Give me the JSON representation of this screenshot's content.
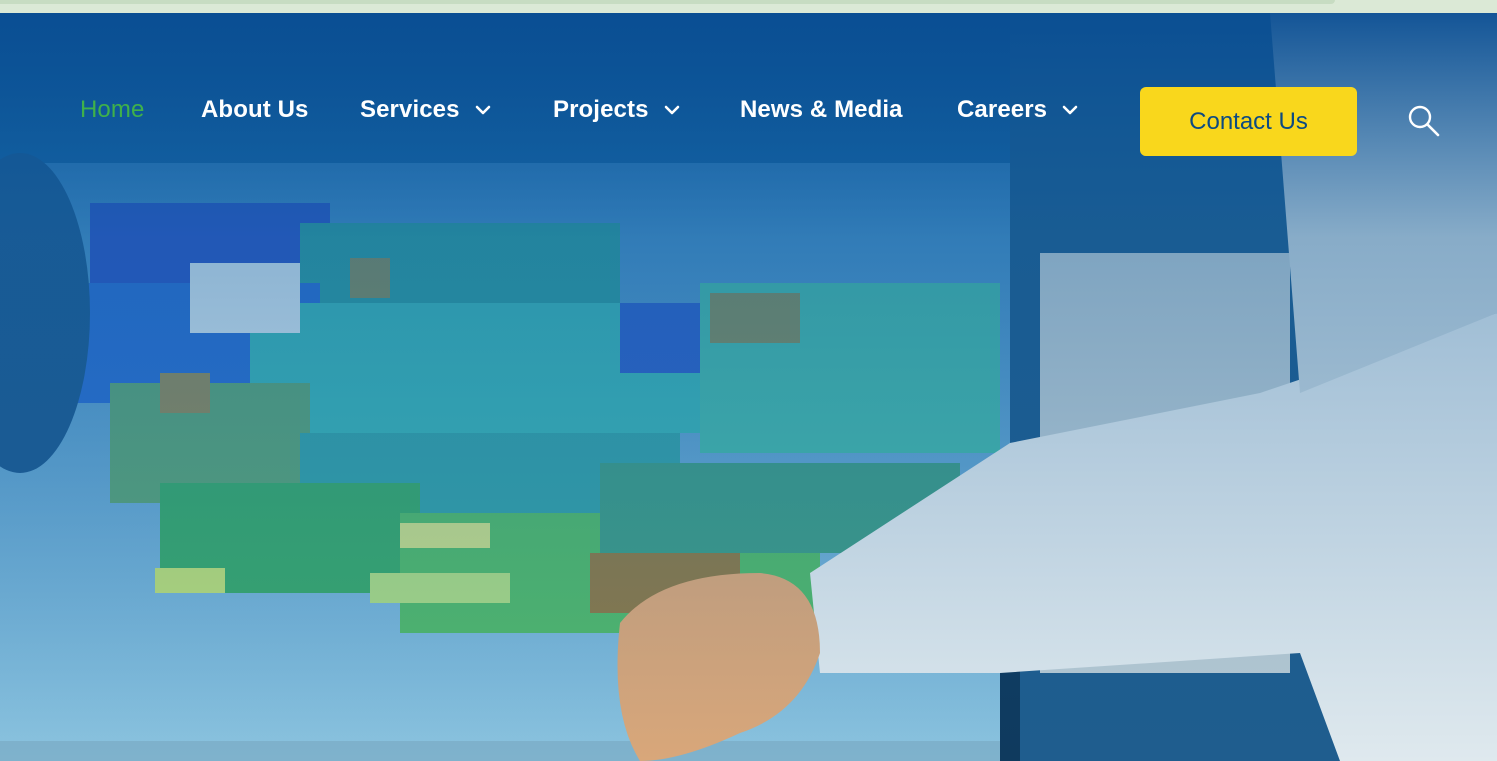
{
  "nav": {
    "items": [
      {
        "label": "Home",
        "active": true,
        "dropdown": false
      },
      {
        "label": "About Us",
        "active": false,
        "dropdown": false
      },
      {
        "label": "Services",
        "active": false,
        "dropdown": true
      },
      {
        "label": "Projects",
        "active": false,
        "dropdown": true
      },
      {
        "label": "News & Media",
        "active": false,
        "dropdown": false
      },
      {
        "label": "Careers",
        "active": false,
        "dropdown": true
      }
    ],
    "cta_label": "Contact Us",
    "search_icon": "search-icon",
    "chevron_icon": "chevron-down-icon"
  },
  "colors": {
    "nav_background": "#0b4f93",
    "active_link": "#3fb14a",
    "nav_link": "#ffffff",
    "cta_background": "#f9d71c",
    "cta_text": "#0c4a82"
  },
  "hero": {
    "image": "people-pointing-at-3d-voxel-model-on-monitor"
  }
}
